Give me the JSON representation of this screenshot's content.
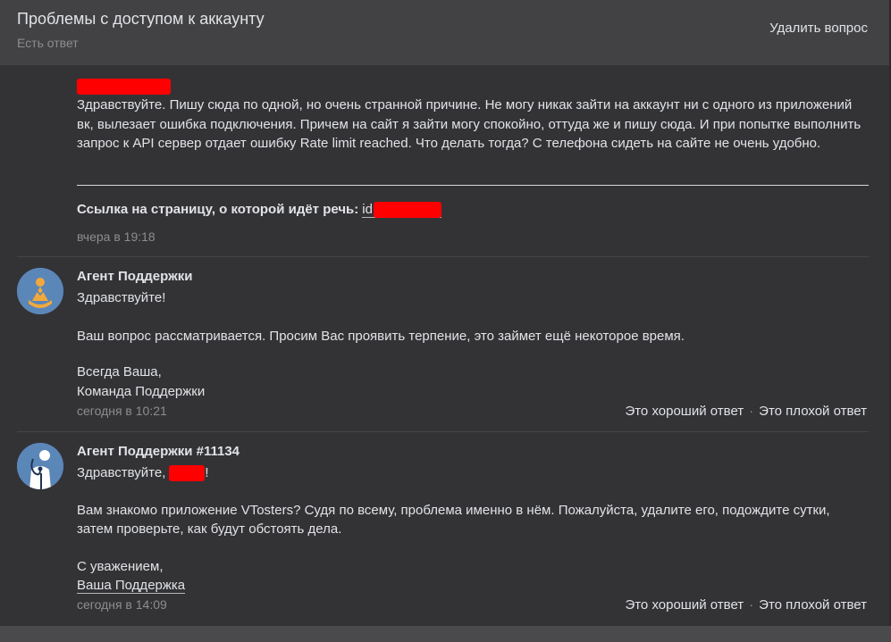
{
  "header": {
    "title": "Проблемы с доступом к аккаунту",
    "status": "Есть ответ",
    "delete_label": "Удалить вопрос"
  },
  "question": {
    "text": "Здравствуйте. Пишу сюда по одной, но очень странной причине. Не могу никак зайти на аккаунт ни с одного из приложений вк, вылезает ошибка подключения. Причем на сайт я зайти могу спокойно, оттуда же и пишу сюда. И при попытке выполнить запрос к API сервер отдает ошибку Rate limit reached. Что делать тогда? С телефона сидеть на сайте не очень удобно.",
    "link_label": "Ссылка на страницу, о которой идёт речь:",
    "link_value_prefix": "id",
    "time": "вчера в 19:18"
  },
  "answers": [
    {
      "author": "Агент Поддержки",
      "greeting": "Здравствуйте!",
      "body": "Ваш вопрос рассматривается. Просим Вас проявить терпение, это займет ещё некоторое время.",
      "sign1": "Всегда Ваша,",
      "sign2": "Команда Поддержки",
      "time": "сегодня в 10:21",
      "good_label": "Это хороший ответ",
      "bad_label": "Это плохой ответ",
      "dot": "·"
    },
    {
      "author": "Агент Поддержки #11134",
      "greeting": "Здравствуйте,",
      "greeting_end": "!",
      "body1": "Вам знакомо приложение VTosters? Судя по всему, проблема именно в нём. Пожалуйста, удалите его, подождите сутки,",
      "body2": "затем проверьте, как будут обстоять дела.",
      "sign1": "С уважением,",
      "sign2": "Ваша Поддержка",
      "time": "сегодня в 14:09",
      "good_label": "Это хороший ответ",
      "bad_label": "Это плохой ответ",
      "dot": "·"
    }
  ],
  "colors": {
    "background": "#333336",
    "header": "#424244",
    "muted": "#8d8d90",
    "redaction": "#ff0000",
    "avatar": "#5b86b8"
  },
  "icons": [
    "meditating-agent-avatar",
    "doctor-agent-avatar"
  ]
}
